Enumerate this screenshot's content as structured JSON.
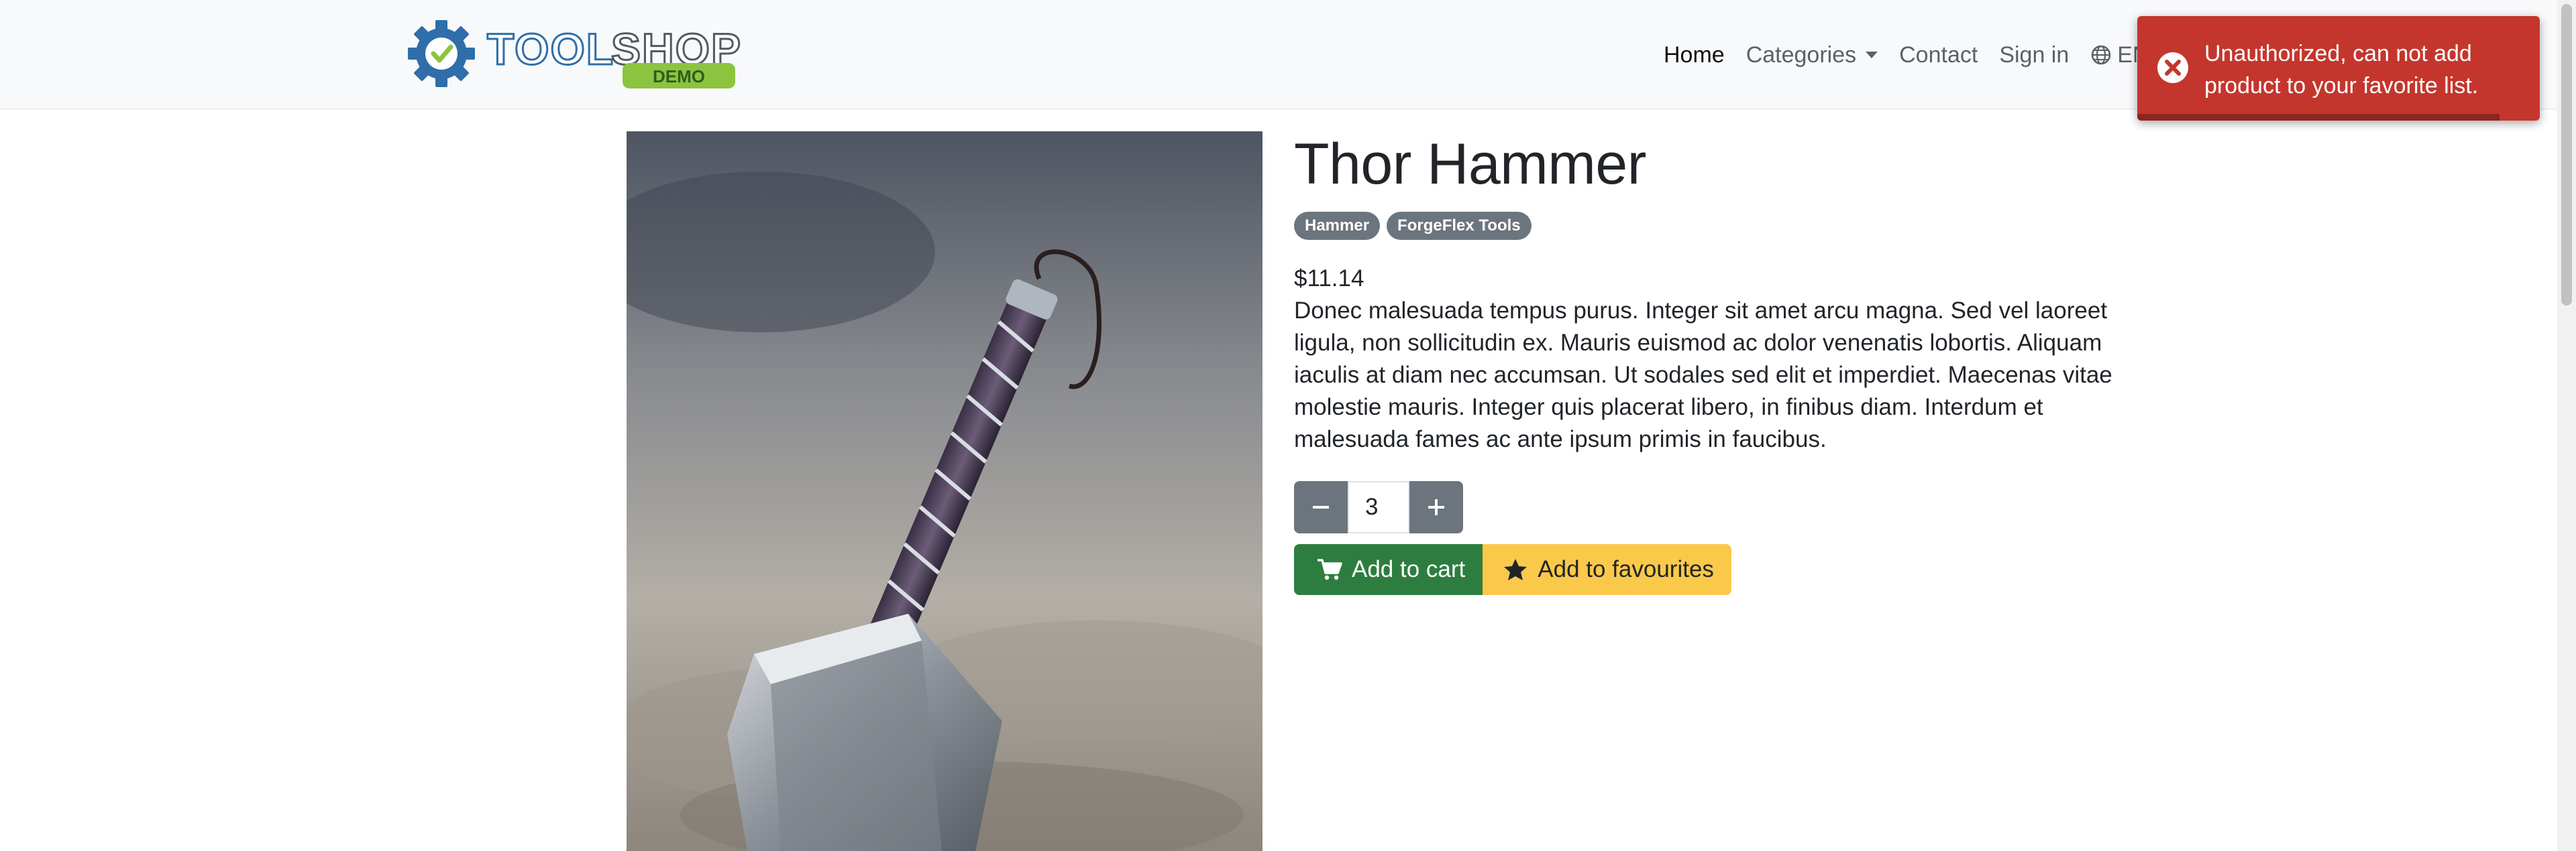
{
  "brand": {
    "name": "TOOLSHOP",
    "tag": "DEMO"
  },
  "nav": {
    "items": [
      {
        "label": "Home"
      },
      {
        "label": "Categories"
      },
      {
        "label": "Contact"
      },
      {
        "label": "Sign in"
      }
    ],
    "language": "EN"
  },
  "toast": {
    "message": "Unauthorized, can not add product to your favorite list.",
    "progress": 0.9
  },
  "product": {
    "title": "Thor Hammer",
    "badges": [
      "Hammer",
      "ForgeFlex Tools"
    ],
    "price": "$11.14",
    "description": "Donec malesuada tempus purus. Integer sit amet arcu magna. Sed vel laoreet ligula, non sollicitudin ex. Mauris euismod ac dolor venenatis lobortis. Aliquam iaculis at diam nec accumsan. Ut sodales sed elit et imperdiet. Maecenas vitae molestie mauris. Integer quis placerat libero, in finibus diam. Interdum et malesuada fames ac ante ipsum primis in faucibus.",
    "quantity": "3",
    "add_to_cart": "Add to cart",
    "add_to_favourites": "Add to favourites"
  },
  "icons": {
    "brand_logo": "gear-check-icon",
    "language": "globe-icon",
    "toast": "error-circle-icon",
    "minus": "minus-icon",
    "plus": "plus-icon",
    "cart": "cart-icon",
    "favourite": "star-icon"
  },
  "colors": {
    "navbar_bg": "#f8f9fa",
    "toast_bg": "#c4362d",
    "badge_bg": "#6c757d",
    "cart_button": "#2e7d40",
    "favourite_button": "#fbc94a",
    "logo_blue": "#2f6ea8",
    "logo_green": "#8cc43f"
  }
}
